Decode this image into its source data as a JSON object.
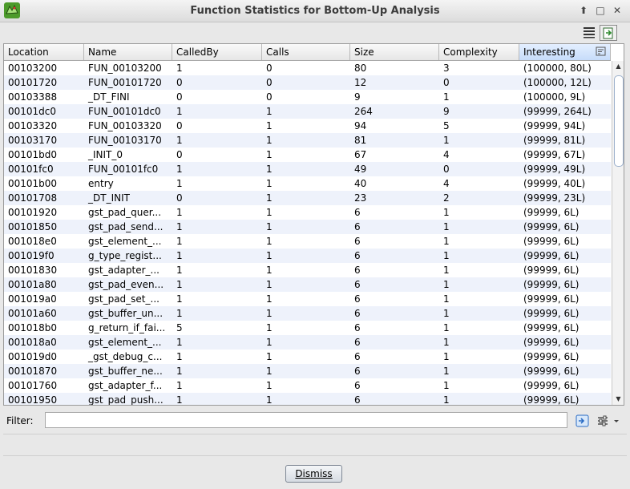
{
  "window": {
    "title": "Function Statistics for Bottom-Up Analysis",
    "controls": [
      "up-icon",
      "maximize-icon",
      "close-icon"
    ]
  },
  "toolbar": {
    "buttons": [
      "table-view-icon",
      "export-icon"
    ]
  },
  "table": {
    "columns": [
      "Location",
      "Name",
      "CalledBy",
      "Calls",
      "Size",
      "Complexity",
      "Interesting"
    ],
    "sorted_column": "Interesting",
    "rows": [
      [
        "00103200",
        "FUN_00103200",
        "1",
        "0",
        "80",
        "3",
        "(100000, 80L)"
      ],
      [
        "00101720",
        "FUN_00101720",
        "0",
        "0",
        "12",
        "0",
        "(100000, 12L)"
      ],
      [
        "00103388",
        "_DT_FINI",
        "0",
        "0",
        "9",
        "1",
        "(100000, 9L)"
      ],
      [
        "00101dc0",
        "FUN_00101dc0",
        "1",
        "1",
        "264",
        "9",
        "(99999, 264L)"
      ],
      [
        "00103320",
        "FUN_00103320",
        "0",
        "1",
        "94",
        "5",
        "(99999, 94L)"
      ],
      [
        "00103170",
        "FUN_00103170",
        "1",
        "1",
        "81",
        "1",
        "(99999, 81L)"
      ],
      [
        "00101bd0",
        "_INIT_0",
        "0",
        "1",
        "67",
        "4",
        "(99999, 67L)"
      ],
      [
        "00101fc0",
        "FUN_00101fc0",
        "1",
        "1",
        "49",
        "0",
        "(99999, 49L)"
      ],
      [
        "00101b00",
        "entry",
        "1",
        "1",
        "40",
        "4",
        "(99999, 40L)"
      ],
      [
        "00101708",
        "_DT_INIT",
        "0",
        "1",
        "23",
        "2",
        "(99999, 23L)"
      ],
      [
        "00101920",
        "gst_pad_quer...",
        "1",
        "1",
        "6",
        "1",
        "(99999, 6L)"
      ],
      [
        "00101850",
        "gst_pad_send...",
        "1",
        "1",
        "6",
        "1",
        "(99999, 6L)"
      ],
      [
        "001018e0",
        "gst_element_...",
        "1",
        "1",
        "6",
        "1",
        "(99999, 6L)"
      ],
      [
        "001019f0",
        "g_type_regist...",
        "1",
        "1",
        "6",
        "1",
        "(99999, 6L)"
      ],
      [
        "00101830",
        "gst_adapter_...",
        "1",
        "1",
        "6",
        "1",
        "(99999, 6L)"
      ],
      [
        "00101a80",
        "gst_pad_even...",
        "1",
        "1",
        "6",
        "1",
        "(99999, 6L)"
      ],
      [
        "001019a0",
        "gst_pad_set_...",
        "1",
        "1",
        "6",
        "1",
        "(99999, 6L)"
      ],
      [
        "00101a60",
        "gst_buffer_un...",
        "1",
        "1",
        "6",
        "1",
        "(99999, 6L)"
      ],
      [
        "001018b0",
        "g_return_if_fai...",
        "5",
        "1",
        "6",
        "1",
        "(99999, 6L)"
      ],
      [
        "001018a0",
        "gst_element_...",
        "1",
        "1",
        "6",
        "1",
        "(99999, 6L)"
      ],
      [
        "001019d0",
        "_gst_debug_c...",
        "1",
        "1",
        "6",
        "1",
        "(99999, 6L)"
      ],
      [
        "00101870",
        "gst_buffer_ne...",
        "1",
        "1",
        "6",
        "1",
        "(99999, 6L)"
      ],
      [
        "00101760",
        "gst_adapter_f...",
        "1",
        "1",
        "6",
        "1",
        "(99999, 6L)"
      ],
      [
        "00101950",
        "gst_pad_push...",
        "1",
        "1",
        "6",
        "1",
        "(99999, 6L)"
      ]
    ]
  },
  "filter": {
    "label": "Filter:",
    "value": "",
    "placeholder": ""
  },
  "dismiss": {
    "label": "Dismiss",
    "mnemonic": "D"
  },
  "colors": {
    "alt_row": "#eef2fb",
    "sorted_header": "#c6dcfa",
    "scroll_thumb_border": "#9cb0cc"
  }
}
